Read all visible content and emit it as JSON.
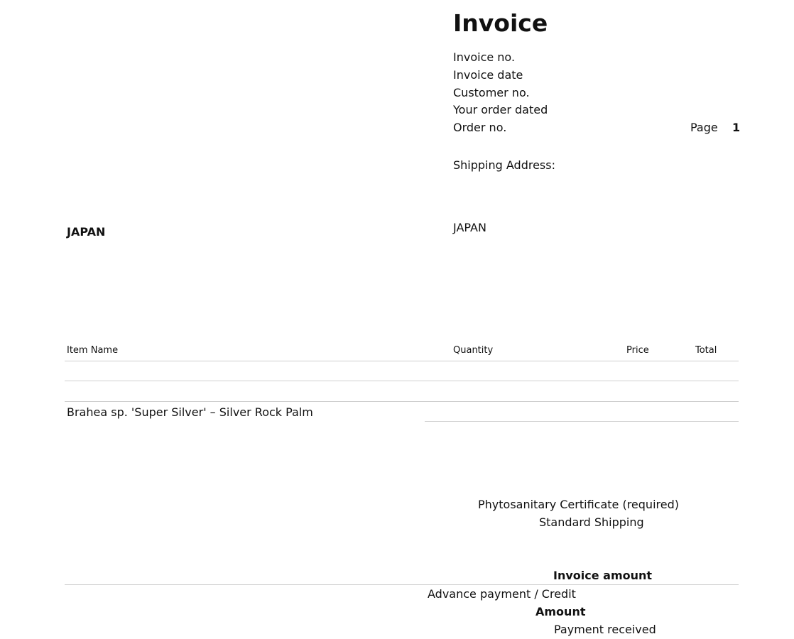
{
  "header": {
    "title": "Invoice",
    "fields": [
      "Invoice no.",
      "Invoice date",
      "Customer no.",
      "Your order dated",
      "Order no."
    ],
    "page_label": "Page",
    "page_number": "1",
    "shipping_label": "Shipping Address:",
    "shipping_country": "JAPAN"
  },
  "billing": {
    "country": "JAPAN"
  },
  "table": {
    "columns": [
      "Item Name",
      "Quantity",
      "Price",
      "Total"
    ],
    "items": [
      "Brahea sp. 'Super Silver' – Silver Rock Palm"
    ]
  },
  "extras": {
    "lines": [
      "Phytosanitary Certificate (required)",
      "Standard Shipping"
    ]
  },
  "totals": {
    "invoice_amount": "Invoice amount",
    "advance_payment": "Advance payment / Credit",
    "amount": "Amount",
    "payment_received": "Payment received"
  }
}
